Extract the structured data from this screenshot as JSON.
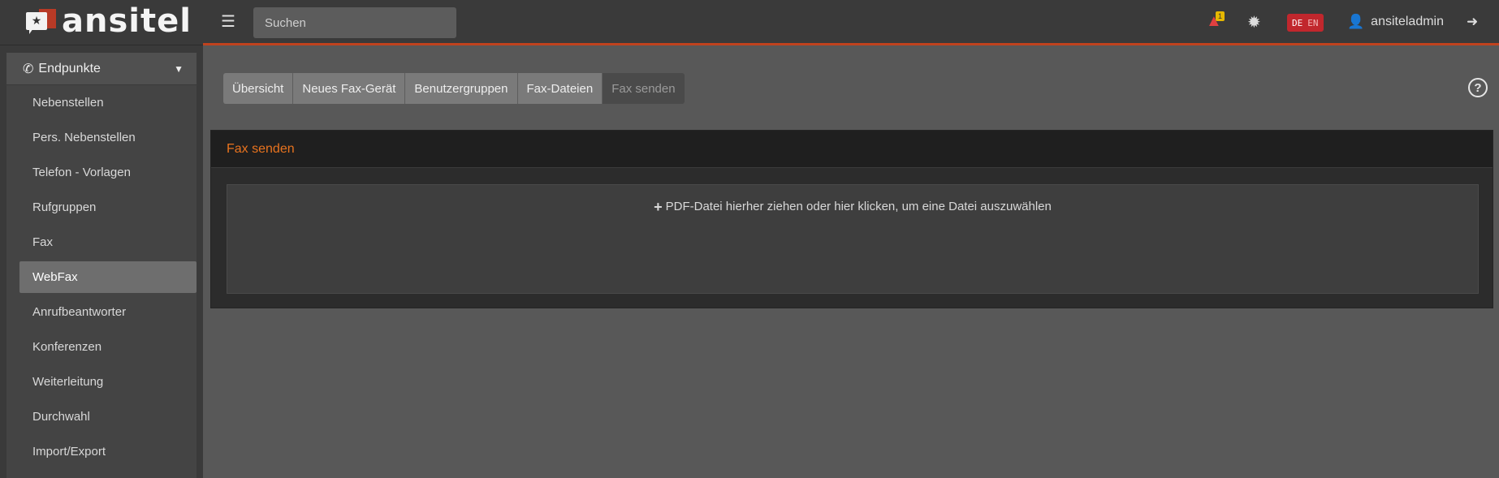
{
  "logo": {
    "text": "ansitel"
  },
  "sidebar": {
    "section_label": "Endpunkte",
    "items": [
      {
        "label": "Nebenstellen"
      },
      {
        "label": "Pers. Nebenstellen"
      },
      {
        "label": "Telefon - Vorlagen"
      },
      {
        "label": "Rufgruppen"
      },
      {
        "label": "Fax"
      },
      {
        "label": "WebFax"
      },
      {
        "label": "Anrufbeantworter"
      },
      {
        "label": "Konferenzen"
      },
      {
        "label": "Weiterleitung"
      },
      {
        "label": "Durchwahl"
      },
      {
        "label": "Import/Export"
      }
    ],
    "active_item": "WebFax"
  },
  "topbar": {
    "search_placeholder": "Suchen",
    "alert_count": "1",
    "lang_de": "DE",
    "lang_en": "EN",
    "username": "ansiteladmin"
  },
  "tabs": [
    {
      "label": "Übersicht"
    },
    {
      "label": "Neues Fax-Gerät"
    },
    {
      "label": "Benutzergruppen"
    },
    {
      "label": "Fax-Dateien"
    },
    {
      "label": "Fax senden"
    }
  ],
  "panel": {
    "title": "Fax senden",
    "dropzone_text": "PDF-Datei hierher ziehen oder hier klicken, um eine Datei auszuwählen"
  },
  "colors": {
    "accent": "#c0421e",
    "panel_title": "#e8731f",
    "lang_badge": "#c1272d",
    "alert_badge": "#e6b800"
  }
}
